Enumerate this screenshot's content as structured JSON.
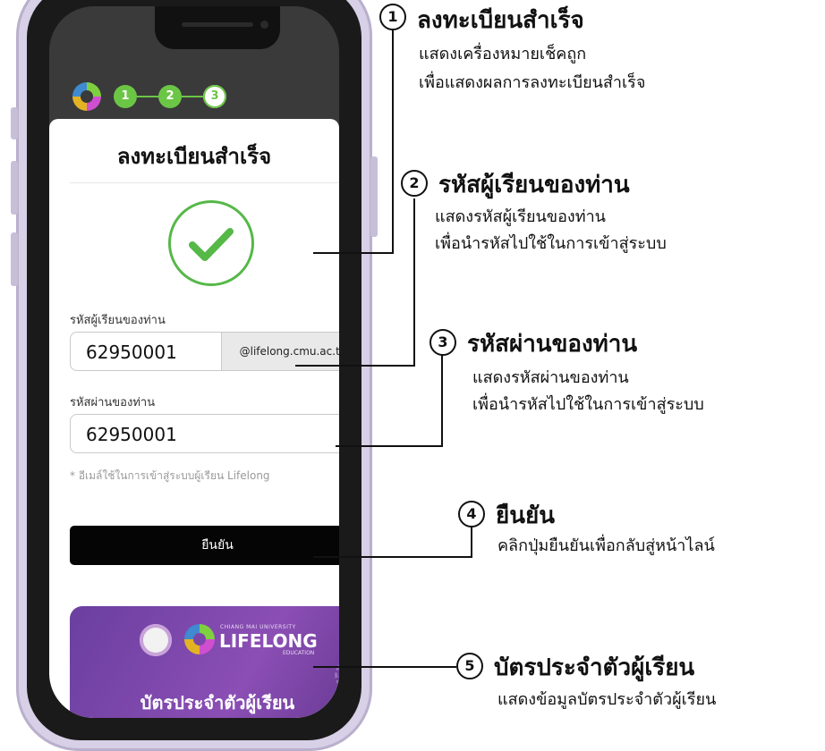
{
  "screen": {
    "steps": [
      "1",
      "2",
      "3"
    ],
    "close_icon": "close-icon",
    "title": "ลงทะเบียนสำเร็จ",
    "success_icon": "check-icon",
    "username": {
      "label": "รหัสผู้เรียนของท่าน",
      "value": "62950001",
      "suffix": "@lifelong.cmu.ac.th"
    },
    "password": {
      "label": "รหัสผ่านของท่าน",
      "value": "62950001"
    },
    "note": "* อีเมล์ใช้ในการเข้าสู่ระบบผู้เรียน Lifelong",
    "confirm_label": "ยืนยัน",
    "student_card": {
      "brand_top": "CHIANG MAI UNIVERSITY",
      "brand_main": "LIFELONG",
      "brand_sub": "EDUCATION",
      "title": "บัตรประจำตัวผู้เรียน"
    }
  },
  "annotations": [
    {
      "number": "1",
      "title": "ลงทะเบียนสำเร็จ",
      "desc": [
        "แสดงเครื่องหมายเช็คถูก",
        "เพื่อแสดงผลการลงทะเบียนสำเร็จ"
      ]
    },
    {
      "number": "2",
      "title": "รหัสผู้เรียนของท่าน",
      "desc": [
        "แสดงรหัสผู้เรียนของท่าน",
        "เพื่อนำรหัสไปใช้ในการเข้าสู่ระบบ"
      ]
    },
    {
      "number": "3",
      "title": "รหัสผ่านของท่าน",
      "desc": [
        "แสดงรหัสผ่านของท่าน",
        "เพื่อนำรหัสไปใช้ในการเข้าสู่ระบบ"
      ]
    },
    {
      "number": "4",
      "title": "ยืนยัน",
      "desc": [
        "คลิกปุ่มยืนยันเพื่อกลับสู่หน้าไลน์"
      ]
    },
    {
      "number": "5",
      "title": "บัตรประจำตัวผู้เรียน",
      "desc": [
        "แสดงข้อมูลบัตรประจำตัวผู้เรียน"
      ]
    }
  ],
  "colors": {
    "accent_green": "#55b847",
    "card_purple": "#7a47a8",
    "button_black": "#050505"
  }
}
